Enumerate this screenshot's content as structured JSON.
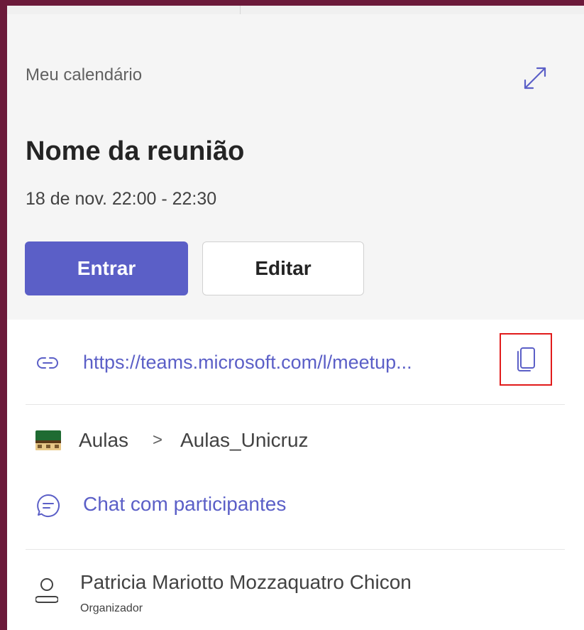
{
  "calendar": {
    "label": "Meu calendário"
  },
  "meeting": {
    "title": "Nome da reunião",
    "time": "18 de nov. 22:00 - 22:30",
    "join_label": "Entrar",
    "edit_label": "Editar",
    "link": "https://teams.microsoft.com/l/meetup..."
  },
  "channel": {
    "team": "Aulas",
    "separator": ">",
    "name": "Aulas_Unicruz"
  },
  "chat": {
    "label": "Chat com participantes"
  },
  "organizer": {
    "name": "Patricia Mariotto Mozzaquatro Chicon",
    "role": "Organizador"
  },
  "icons": {
    "expand": "expand-icon",
    "link": "link-icon",
    "copy": "copy-icon",
    "channel": "team-channel-icon",
    "chat": "chat-icon",
    "organizer": "person-icon"
  },
  "colors": {
    "accent": "#5b5fc7",
    "highlight": "#e11b1b",
    "header_bg": "#f5f5f5",
    "window_border": "#6b1a3a"
  }
}
